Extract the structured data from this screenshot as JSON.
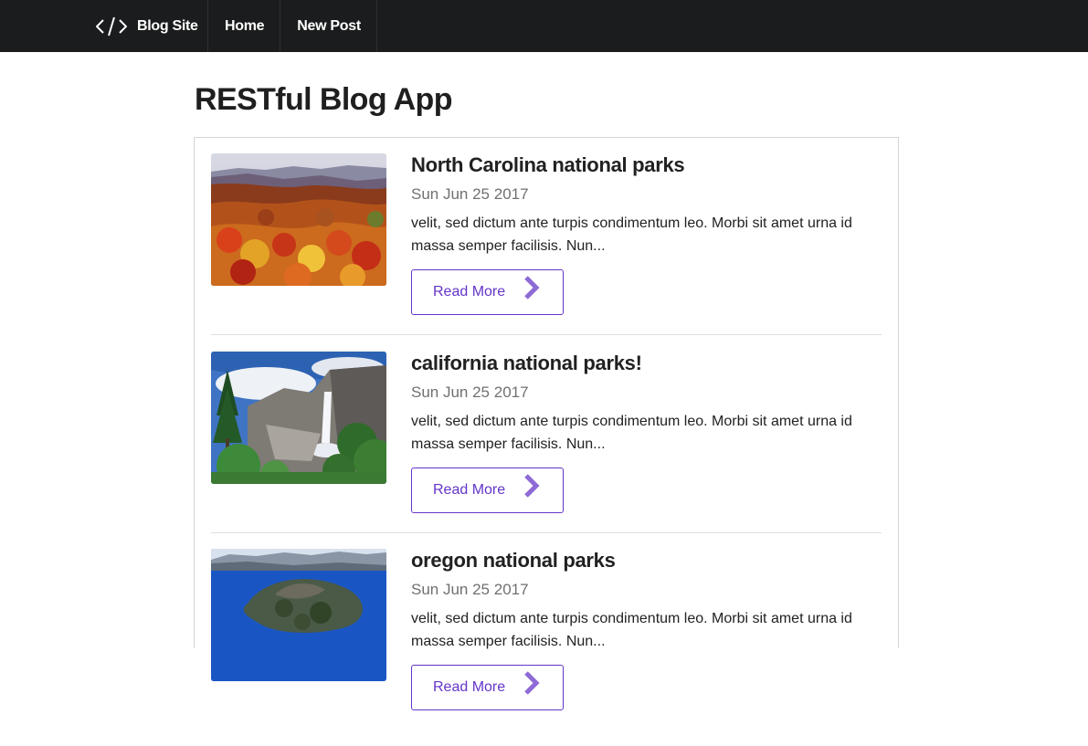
{
  "navbar": {
    "brand_icon": "code-icon",
    "brand_label": "Blog Site",
    "items": [
      {
        "label": "Home"
      },
      {
        "label": "New Post"
      }
    ],
    "background": "#1b1c1d"
  },
  "page": {
    "title": "RESTful Blog App"
  },
  "posts": [
    {
      "title": "North Carolina national parks",
      "date": "Sun Jun 25 2017",
      "excerpt": "velit, sed dictum ante turpis condimentum leo. Morbi sit amet urna id massa semper facilisis. Nun...",
      "button_label": "Read More",
      "image": "autumn-mountains-photo"
    },
    {
      "title": "california national parks!",
      "date": "Sun Jun 25 2017",
      "excerpt": "velit, sed dictum ante turpis condimentum leo. Morbi sit amet urna id massa semper facilisis. Nun...",
      "button_label": "Read More",
      "image": "waterfall-cliff-photo"
    },
    {
      "title": "oregon national parks",
      "date": "Sun Jun 25 2017",
      "excerpt": "velit, sed dictum ante turpis condimentum leo. Morbi sit amet urna id massa semper facilisis. Nun...",
      "button_label": "Read More",
      "image": "crater-lake-photo"
    }
  ],
  "colors": {
    "accent": "#6435c9",
    "chevron": "#8e6ad6"
  }
}
